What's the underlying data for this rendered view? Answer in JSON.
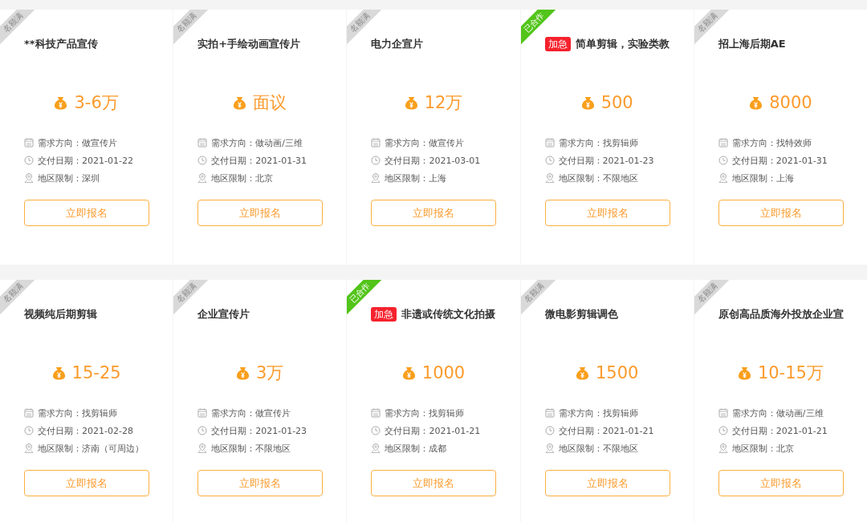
{
  "rows": [
    {
      "cards": [
        {
          "ribbon": {
            "kind": "full",
            "label": "名额满"
          },
          "title": "**科技产品宣传",
          "price": "3-6万",
          "details": [
            {
              "kind": "direction",
              "text": "需求方向：做宣传片"
            },
            {
              "kind": "date",
              "text": "交付日期：2021-01-22"
            },
            {
              "kind": "region",
              "text": "地区限制：深圳"
            }
          ],
          "button": "立即报名"
        },
        {
          "ribbon": {
            "kind": "full",
            "label": "名额满"
          },
          "title": "实拍+手绘动画宣传片",
          "price": "面议",
          "details": [
            {
              "kind": "direction",
              "text": "需求方向：做动画/三维"
            },
            {
              "kind": "date",
              "text": "交付日期：2021-01-31"
            },
            {
              "kind": "region",
              "text": "地区限制：北京"
            }
          ],
          "button": "立即报名"
        },
        {
          "ribbon": {
            "kind": "full",
            "label": "名额满"
          },
          "title": "电力企宣片",
          "price": "12万",
          "details": [
            {
              "kind": "direction",
              "text": "需求方向：做宣传片"
            },
            {
              "kind": "date",
              "text": "交付日期：2021-03-01"
            },
            {
              "kind": "region",
              "text": "地区限制：上海"
            }
          ],
          "button": "立即报名"
        },
        {
          "ribbon": {
            "kind": "cooperated",
            "label": "已合作"
          },
          "urgent": "加急",
          "title": "简单剪辑，实验类教",
          "price": "500",
          "details": [
            {
              "kind": "direction",
              "text": "需求方向：找剪辑师"
            },
            {
              "kind": "date",
              "text": "交付日期：2021-01-23"
            },
            {
              "kind": "region",
              "text": "地区限制：不限地区"
            }
          ],
          "button": "立即报名"
        },
        {
          "ribbon": {
            "kind": "full",
            "label": "名额满"
          },
          "title": "招上海后期AE",
          "price": "8000",
          "details": [
            {
              "kind": "direction",
              "text": "需求方向：找特效师"
            },
            {
              "kind": "date",
              "text": "交付日期：2021-01-31"
            },
            {
              "kind": "region",
              "text": "地区限制：上海"
            }
          ],
          "button": "立即报名"
        }
      ]
    },
    {
      "cards": [
        {
          "ribbon": {
            "kind": "full",
            "label": "名额满"
          },
          "title": "视频纯后期剪辑",
          "price": "15-25",
          "details": [
            {
              "kind": "direction",
              "text": "需求方向：找剪辑师"
            },
            {
              "kind": "date",
              "text": "交付日期：2021-02-28"
            },
            {
              "kind": "region",
              "text": "地区限制：济南（可周边）"
            }
          ],
          "button": "立即报名"
        },
        {
          "ribbon": {
            "kind": "full",
            "label": "名额满"
          },
          "title": "企业宣传片",
          "price": "3万",
          "details": [
            {
              "kind": "direction",
              "text": "需求方向：做宣传片"
            },
            {
              "kind": "date",
              "text": "交付日期：2021-01-23"
            },
            {
              "kind": "region",
              "text": "地区限制：不限地区"
            }
          ],
          "button": "立即报名"
        },
        {
          "ribbon": {
            "kind": "cooperated",
            "label": "已合作"
          },
          "urgent": "加急",
          "title": "非遗或传统文化拍摄",
          "price": "1000",
          "details": [
            {
              "kind": "direction",
              "text": "需求方向：找剪辑师"
            },
            {
              "kind": "date",
              "text": "交付日期：2021-01-21"
            },
            {
              "kind": "region",
              "text": "地区限制：成都"
            }
          ],
          "button": "立即报名"
        },
        {
          "ribbon": {
            "kind": "full",
            "label": "名额满"
          },
          "title": "微电影剪辑调色",
          "price": "1500",
          "details": [
            {
              "kind": "direction",
              "text": "需求方向：找剪辑师"
            },
            {
              "kind": "date",
              "text": "交付日期：2021-01-21"
            },
            {
              "kind": "region",
              "text": "地区限制：不限地区"
            }
          ],
          "button": "立即报名"
        },
        {
          "ribbon": {
            "kind": "full",
            "label": "名额满"
          },
          "title": "原创高品质海外投放企业宣",
          "price": "10-15万",
          "details": [
            {
              "kind": "direction",
              "text": "需求方向：做动画/三维"
            },
            {
              "kind": "date",
              "text": "交付日期：2021-01-21"
            },
            {
              "kind": "region",
              "text": "地区限制：北京"
            }
          ],
          "button": "立即报名"
        }
      ]
    }
  ]
}
